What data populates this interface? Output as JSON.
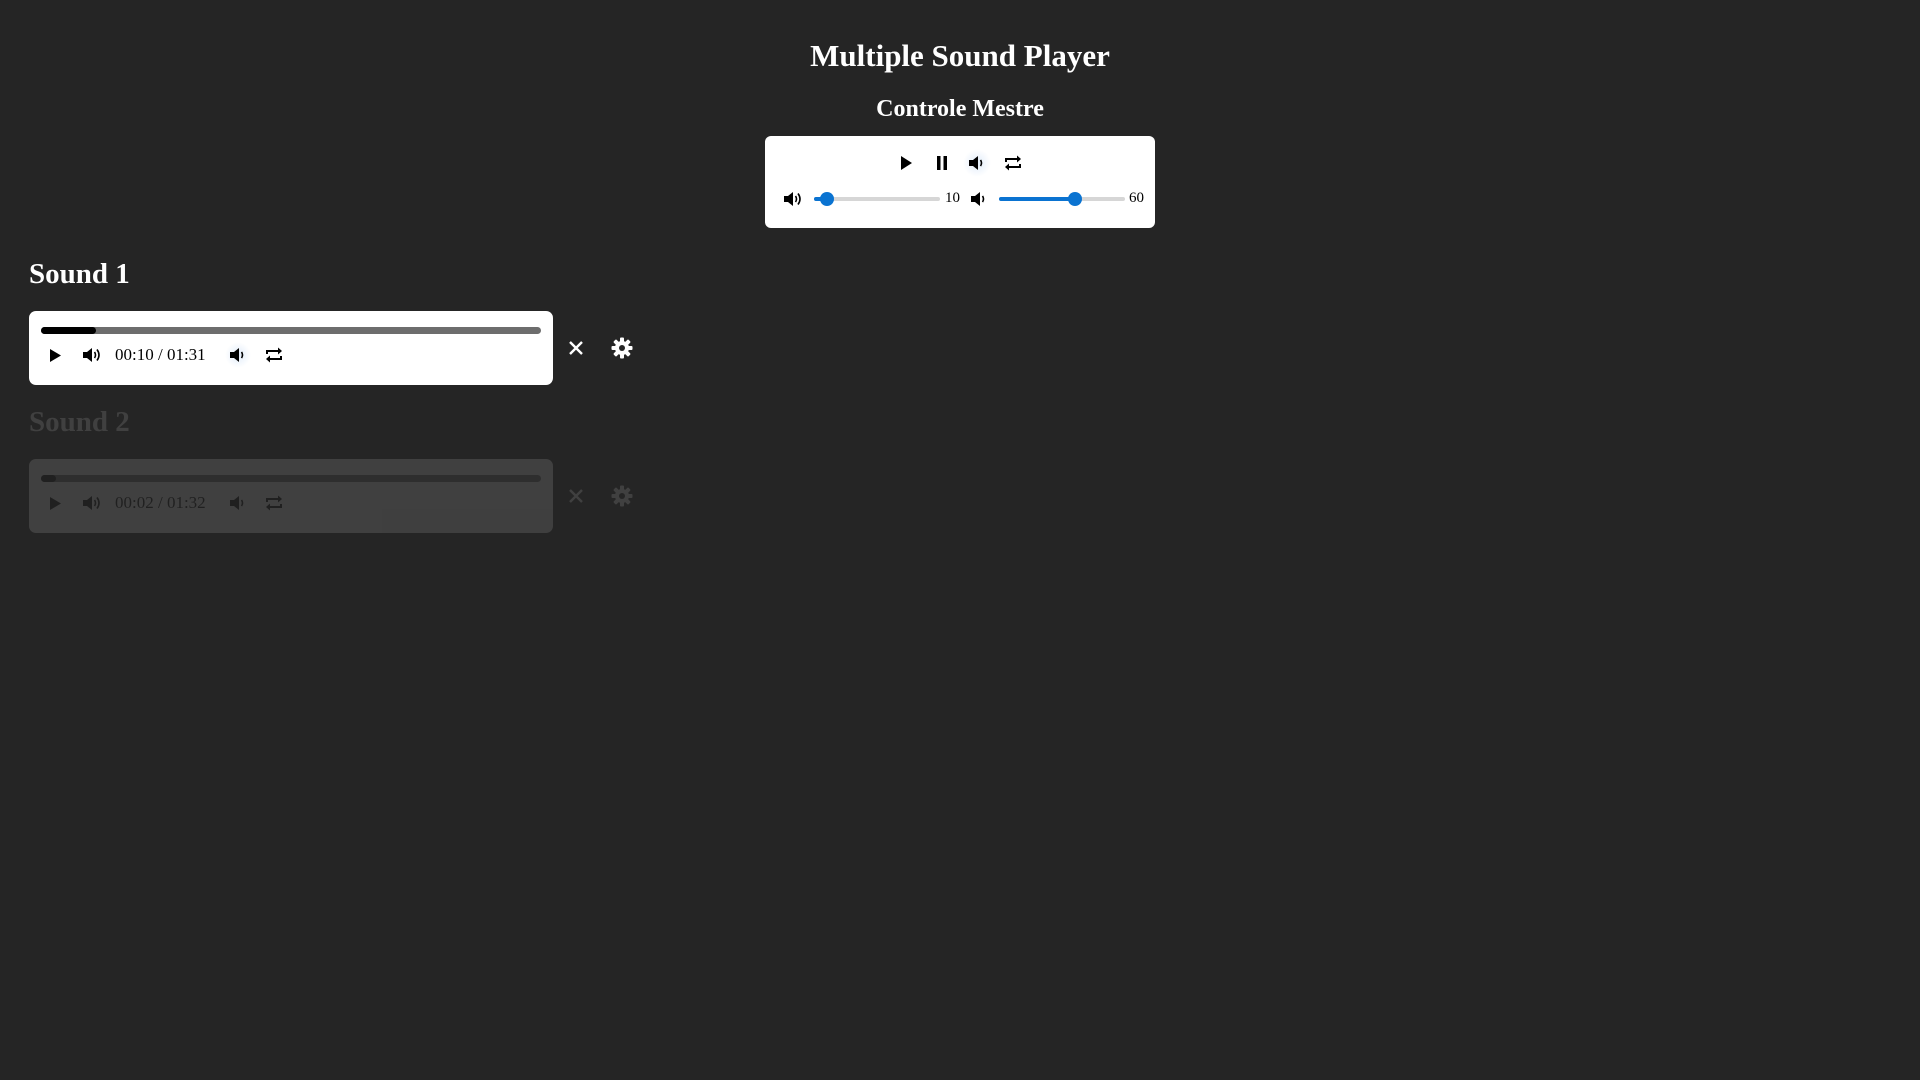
{
  "app": {
    "title": "Multiple Sound Player"
  },
  "master": {
    "title": "Controle Mestre",
    "controls": [
      {
        "name": "play",
        "icon": "play-icon"
      },
      {
        "name": "pause",
        "icon": "pause-icon"
      },
      {
        "name": "mute",
        "icon": "speaker-mute-icon"
      },
      {
        "name": "loop",
        "icon": "repeat-icon"
      }
    ],
    "volume_left": {
      "icon": "speaker-loud-icon",
      "value": "10",
      "level": 0.1
    },
    "volume_right": {
      "icon": "speaker-icon",
      "value": "60",
      "level": 0.6
    }
  },
  "sounds": [
    {
      "title": "Sound 1",
      "time": "00:10 / 01:31",
      "progress": 0.11,
      "enabled": true
    },
    {
      "title": "Sound 2",
      "time": "00:02 / 01:32",
      "progress": 0.03,
      "enabled": false
    }
  ],
  "colors": {
    "background": "#252525",
    "panel": "#ffffff",
    "accent": "#0a73d1"
  }
}
